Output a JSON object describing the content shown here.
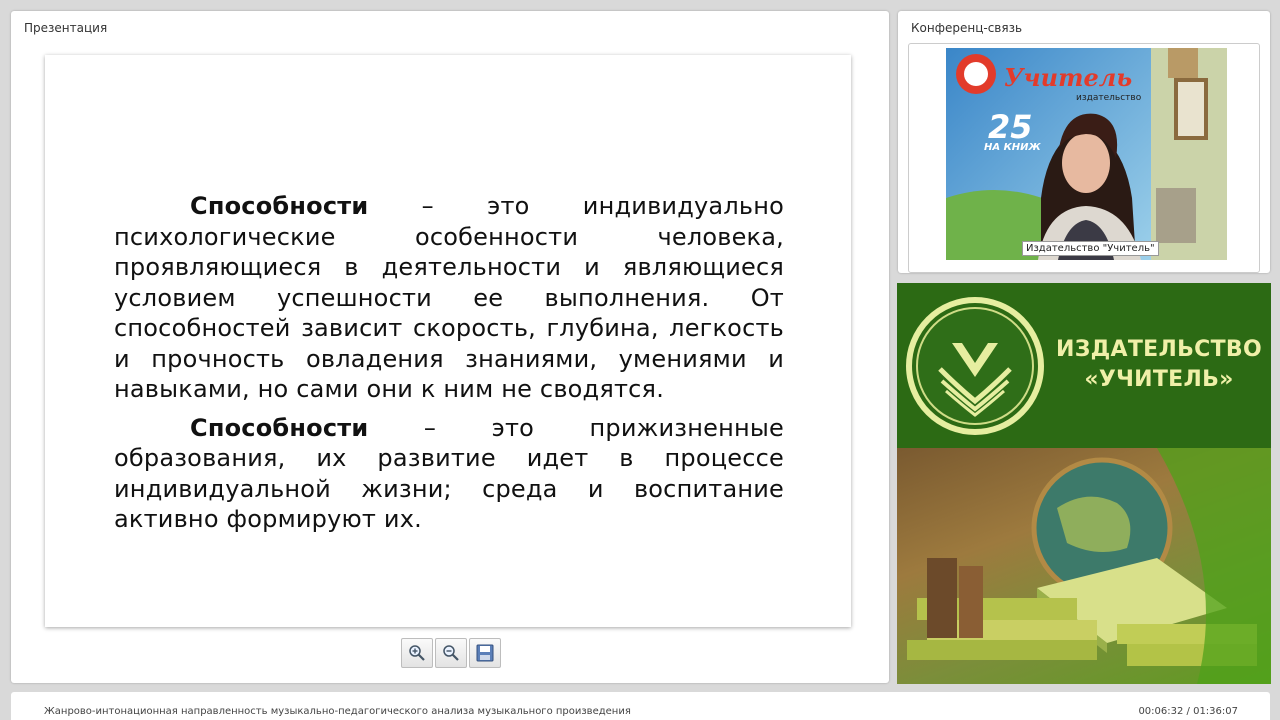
{
  "presentation": {
    "panel_title": "Презентация",
    "slide": {
      "p1_term": "Способности",
      "p1_rest": " – это индивидуально психологические особенности человека, проявляющиеся в деятельности и являющиеся условием успешности ее выполнения. От способностей зависит скорость, глубина, легкость и прочность овладения знаниями, умениями и навыками, но сами они к ним не сводятся.",
      "p2_term": "Способности",
      "p2_rest": " – это прижизненные образования, их развитие идет в процессе индивидуальной жизни; среда и воспитание активно формируют их."
    },
    "tools": [
      {
        "icon": "zoom-in-icon"
      },
      {
        "icon": "zoom-out-icon"
      },
      {
        "icon": "save-icon"
      }
    ]
  },
  "conference": {
    "panel_title": "Конференц-связь",
    "camera_label": "Издательство \"Учитель\"",
    "backdrop": {
      "logo_text": "Учитель",
      "sub_text": "издательство",
      "years": "25",
      "years_caption": "НА КНИЖ"
    }
  },
  "banner": {
    "line1": "ИЗДАТЕЛЬСТВО",
    "line2": "«УЧИТЕЛЬ»",
    "logo_icon": "uchitel-logo-icon"
  },
  "footer": {
    "title": "Жанрово-интонационная направленность музыкально-педагогического анализа музыкального произведения",
    "time": "00:06:32 / 01:36:07"
  },
  "colors": {
    "banner_green": "#2c6a14",
    "banner_text": "#f0f0a8"
  }
}
